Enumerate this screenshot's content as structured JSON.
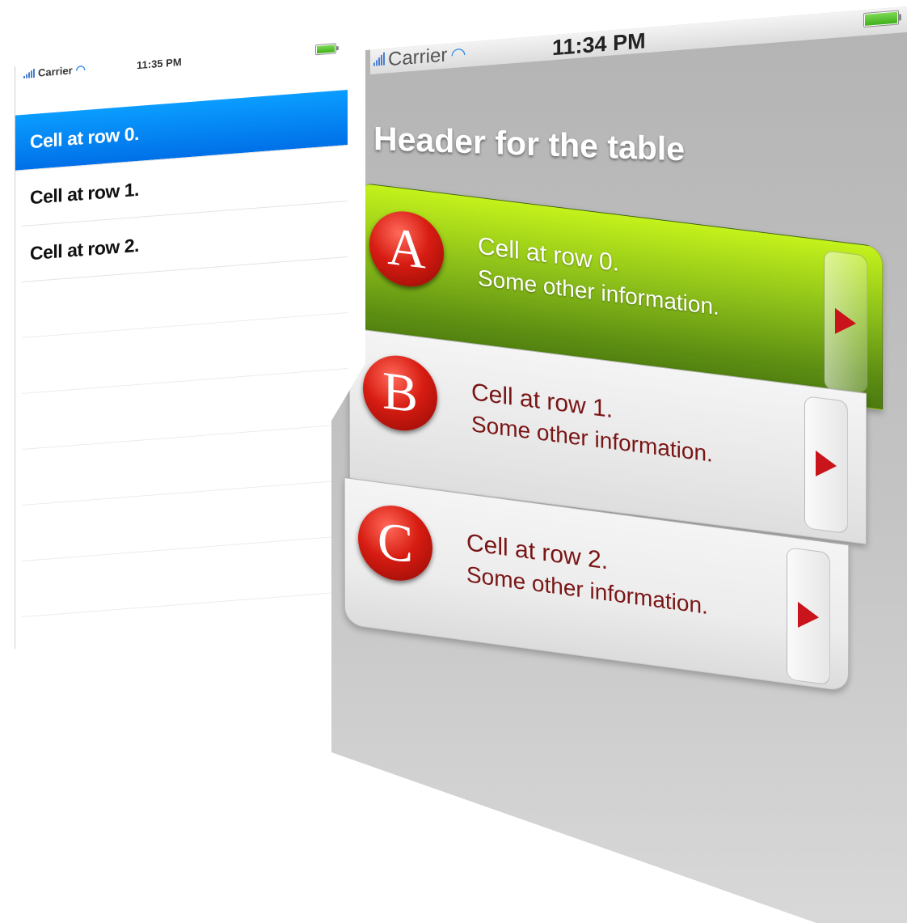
{
  "left_screen": {
    "status_bar": {
      "carrier": "Carrier",
      "time": "11:35 PM"
    },
    "rows": [
      {
        "label": "Cell at row 0.",
        "selected": true
      },
      {
        "label": "Cell at row 1.",
        "selected": false
      },
      {
        "label": "Cell at row 2.",
        "selected": false
      }
    ]
  },
  "right_screen": {
    "status_bar": {
      "carrier": "Carrier",
      "time": "11:34 PM"
    },
    "header": "Header for the table",
    "rows": [
      {
        "badge": "A",
        "title": "Cell at row 0.",
        "subtitle": "Some other information.",
        "selected": true
      },
      {
        "badge": "B",
        "title": "Cell at row 1.",
        "subtitle": "Some other information.",
        "selected": false
      },
      {
        "badge": "C",
        "title": "Cell at row 2.",
        "subtitle": "Some other information.",
        "selected": false
      }
    ]
  },
  "colors": {
    "selection_blue": "#0a8cff",
    "selection_green": "#8fc21a",
    "badge_red": "#d71c12",
    "detail_text_red": "#7a1515"
  }
}
